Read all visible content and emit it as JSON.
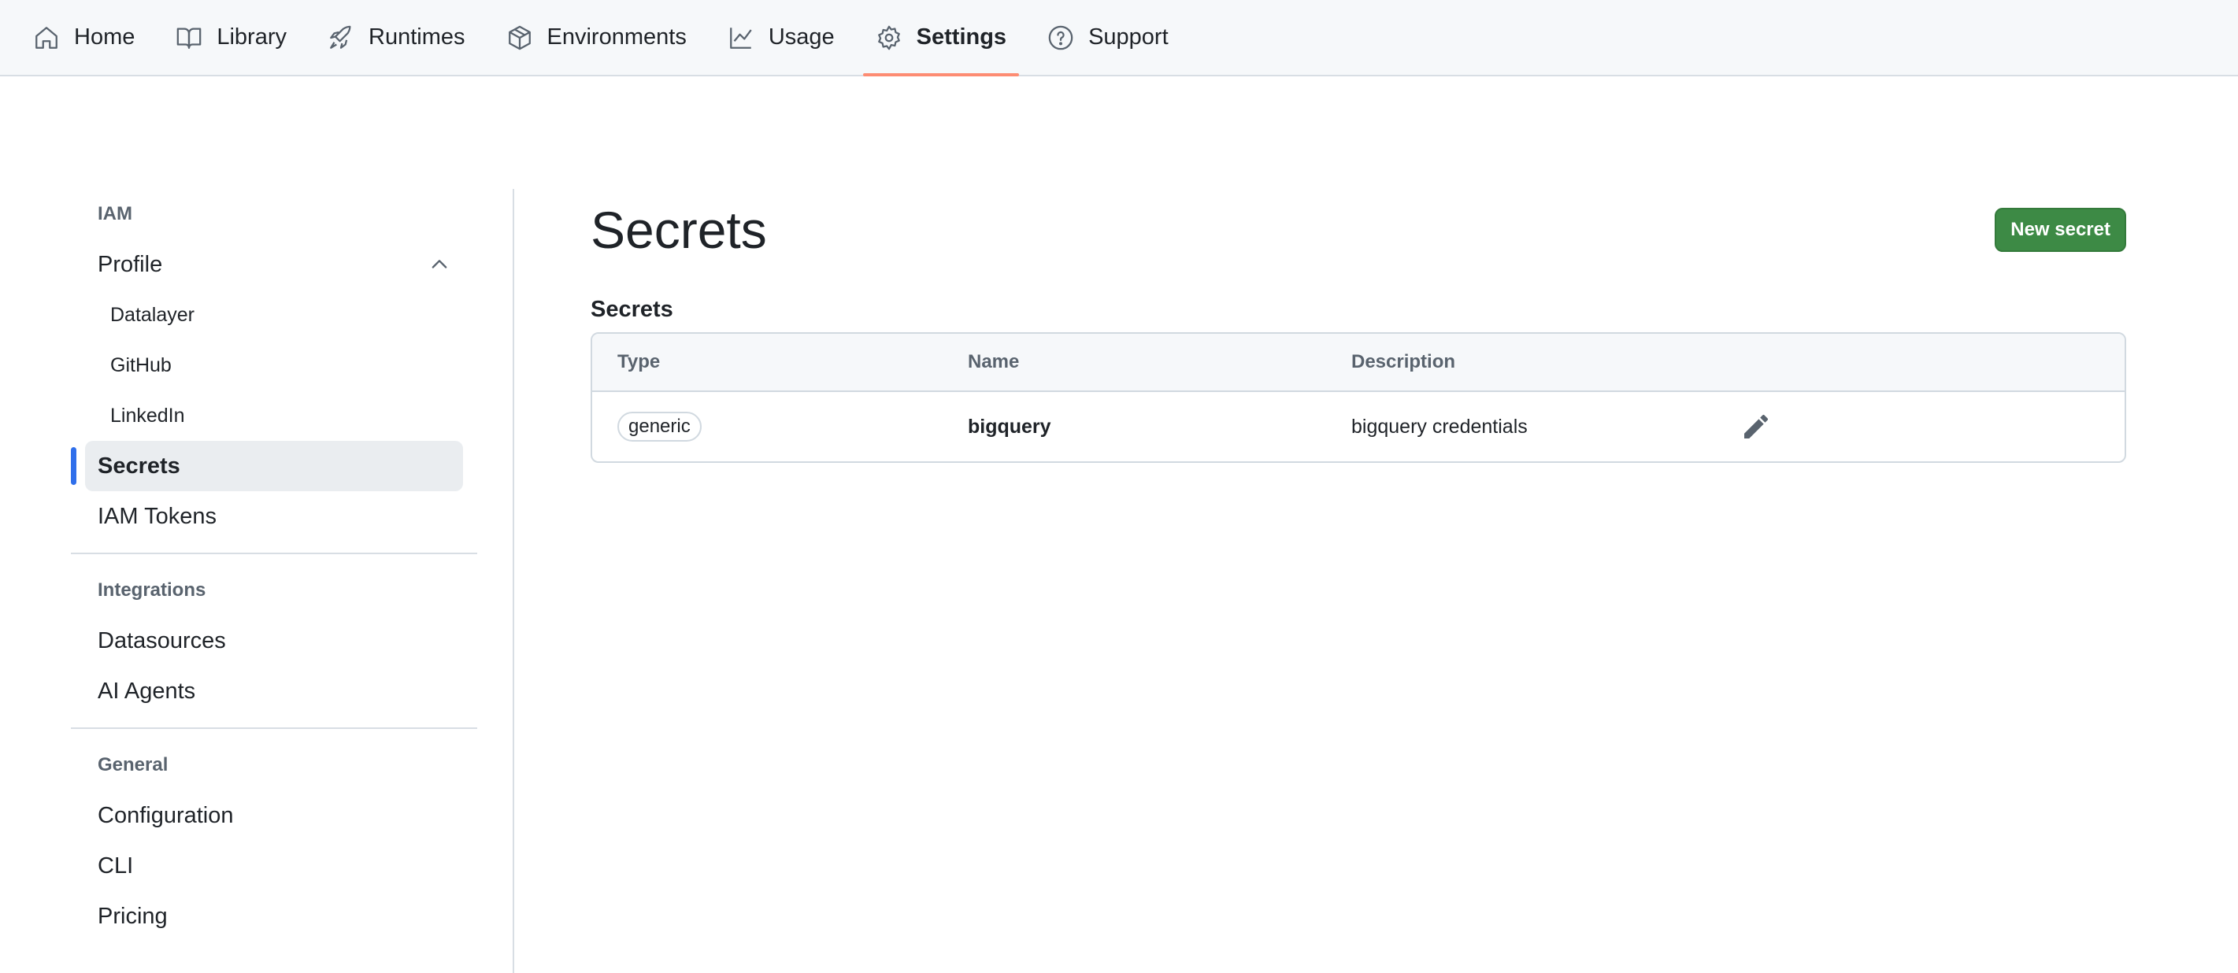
{
  "nav": {
    "items": [
      {
        "label": "Home",
        "icon": "home-icon"
      },
      {
        "label": "Library",
        "icon": "book-icon"
      },
      {
        "label": "Runtimes",
        "icon": "rocket-icon"
      },
      {
        "label": "Environments",
        "icon": "package-icon"
      },
      {
        "label": "Usage",
        "icon": "graph-icon"
      },
      {
        "label": "Settings",
        "icon": "gear-icon",
        "active": true
      },
      {
        "label": "Support",
        "icon": "question-icon"
      }
    ],
    "accent_color": "#fd8c73"
  },
  "sidebar": {
    "sections": [
      {
        "title": "IAM"
      },
      {
        "title": "Integrations"
      },
      {
        "title": "General"
      }
    ],
    "items": {
      "profile": "Profile",
      "datalayer": "Datalayer",
      "github": "GitHub",
      "linkedin": "LinkedIn",
      "secrets": "Secrets",
      "iam_tokens": "IAM Tokens",
      "datasources": "Datasources",
      "ai_agents": "AI Agents",
      "configuration": "Configuration",
      "cli": "CLI",
      "pricing": "Pricing"
    },
    "selected": "Secrets",
    "selected_color": "#2f6feb"
  },
  "main": {
    "title": "Secrets",
    "new_button": "New secret",
    "section_heading": "Secrets",
    "button_color": "#3d8a45",
    "table": {
      "columns": [
        "Type",
        "Name",
        "Description"
      ],
      "rows": [
        {
          "type": "generic",
          "name": "bigquery",
          "description": "bigquery credentials",
          "action_icon": "pencil-icon"
        }
      ]
    }
  }
}
